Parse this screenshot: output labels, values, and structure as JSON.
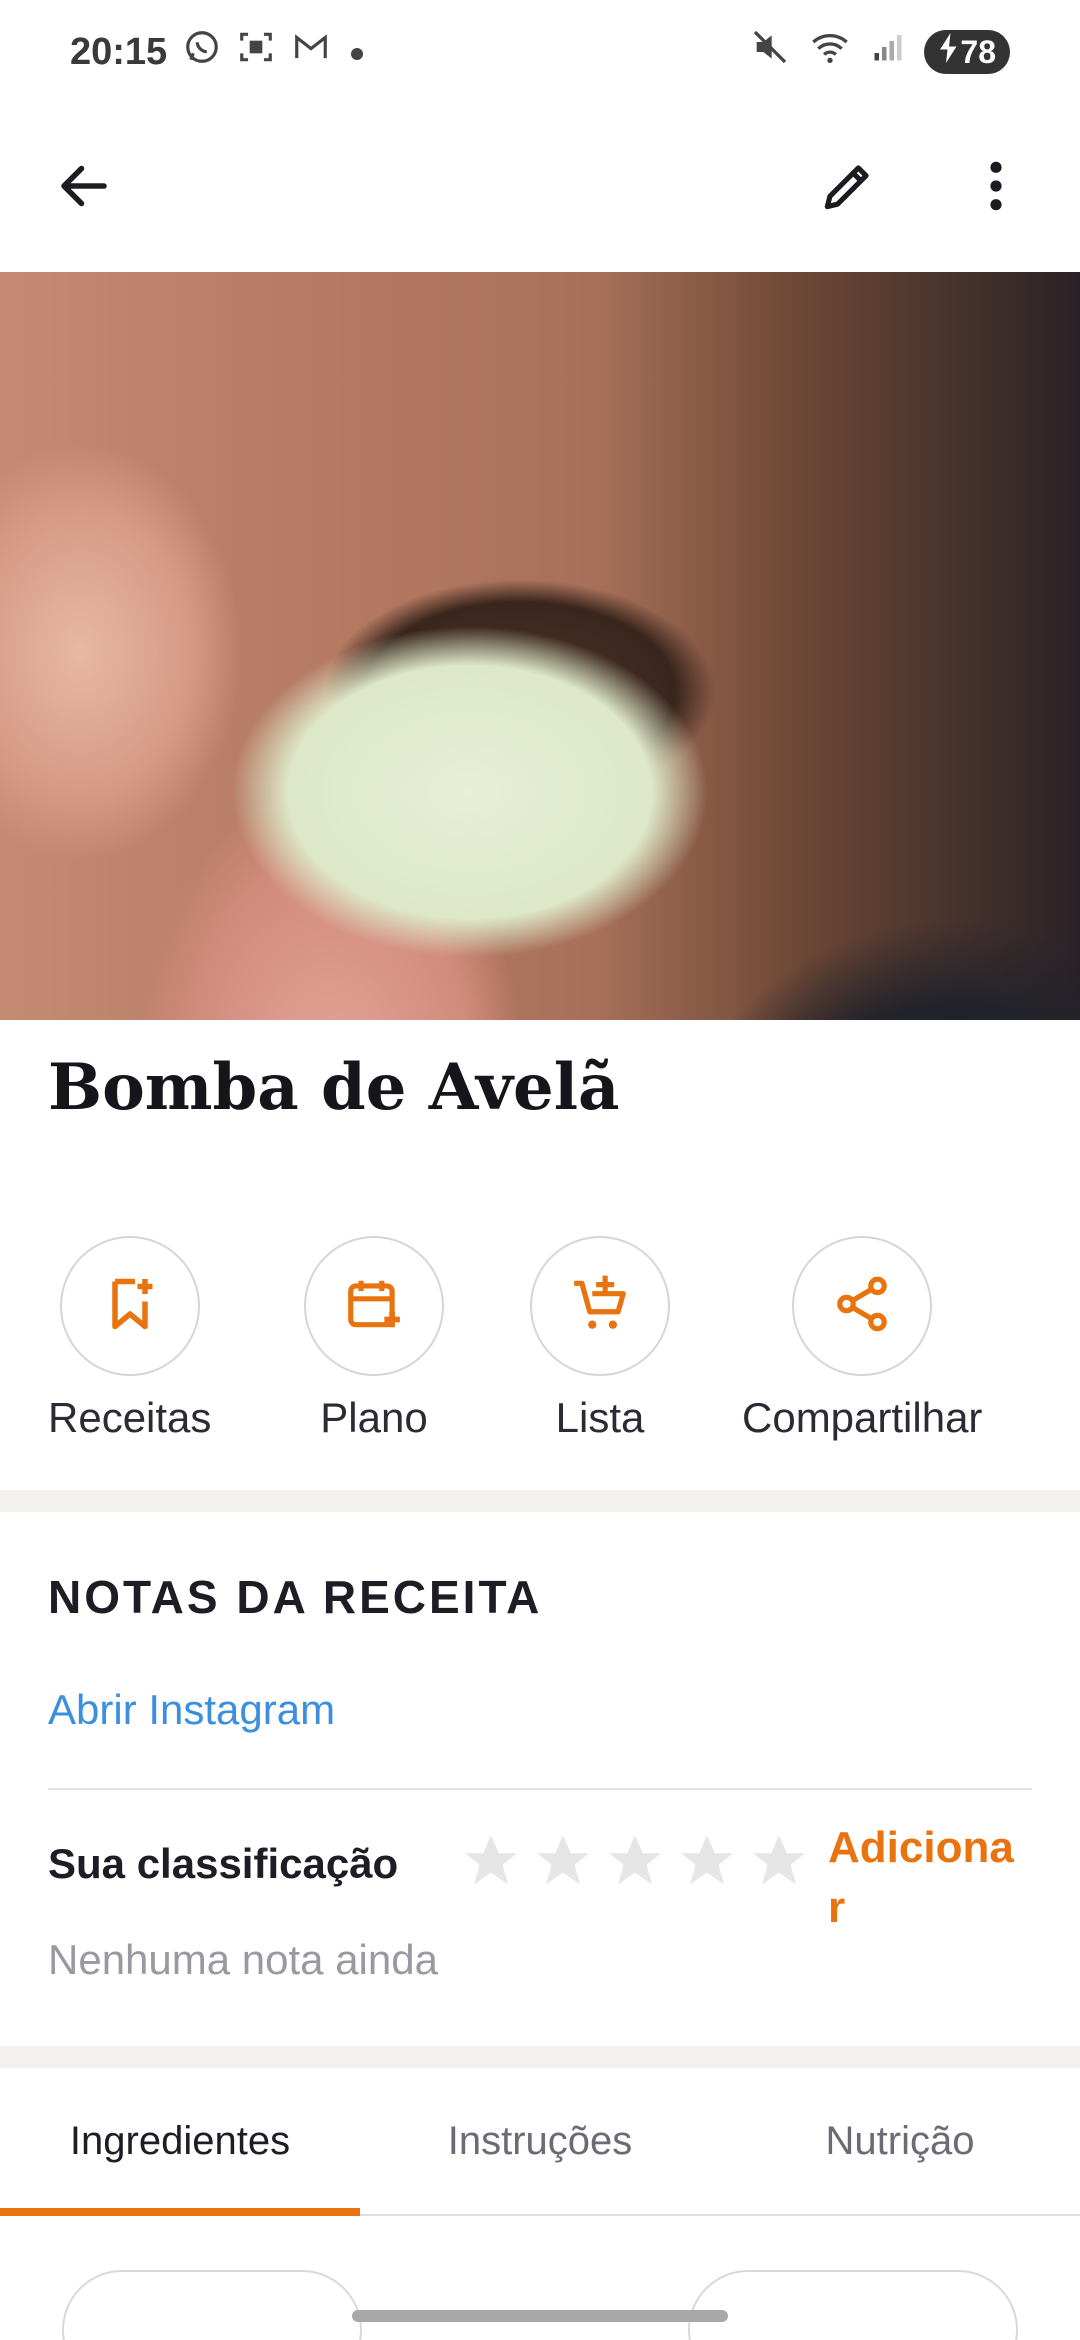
{
  "status_bar": {
    "time": "20:15",
    "notification_icons": [
      "whatsapp-icon",
      "screenshot-icon",
      "gmail-icon",
      "dot-icon"
    ],
    "system_icons": [
      "mute-icon",
      "wifi-icon",
      "signal-icon"
    ],
    "battery": "78"
  },
  "app_bar": {
    "icons": [
      "back-arrow-icon",
      "edit-pencil-icon",
      "more-vert-icon"
    ]
  },
  "recipe": {
    "title": "Bomba de Avelã"
  },
  "actions": [
    {
      "label": "Receitas",
      "icon": "bookmark-add-icon"
    },
    {
      "label": "Plano",
      "icon": "calendar-add-icon"
    },
    {
      "label": "Lista",
      "icon": "cart-add-icon"
    },
    {
      "label": "Compartilhar",
      "icon": "share-icon"
    }
  ],
  "notes": {
    "heading": "NOTAS DA RECEITA",
    "link": "Abrir Instagram"
  },
  "rating": {
    "label": "Sua classificação",
    "stars_filled": 0,
    "stars_total": 5,
    "add": "Adicionar",
    "empty": "Nenhuma nota ainda"
  },
  "tabs": [
    {
      "label": "Ingredientes",
      "active": true
    },
    {
      "label": "Instruções",
      "active": false
    },
    {
      "label": "Nutrição",
      "active": false
    }
  ],
  "colors": {
    "accent": "#e8730f",
    "link": "#3b8fde",
    "muted": "#9a98a0"
  }
}
